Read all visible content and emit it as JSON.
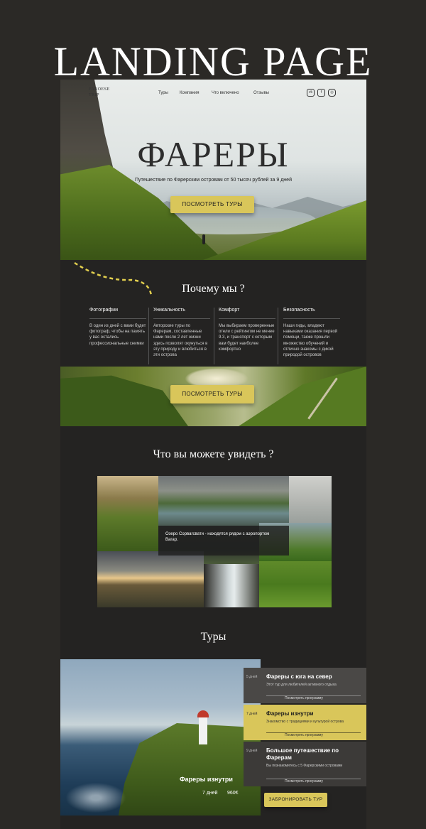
{
  "heading": "LANDING PAGE",
  "nav": {
    "logo": "FAROESE TRIP",
    "links": [
      "Туры",
      "Компания",
      "Что включено",
      "Отзывы"
    ],
    "icons": [
      "vk-icon",
      "facebook-icon",
      "instagram-icon"
    ],
    "icon_glyphs": [
      "vk",
      "f",
      "◎"
    ]
  },
  "hero": {
    "title": "ФАРЕРЫ",
    "subtitle": "Путешествие по Фарерским островам от 50 тысяч рублей за 9 дней",
    "button": "ПОСМОТРЕТЬ ТУРЫ"
  },
  "why": {
    "title": "Почему мы ?",
    "features": [
      {
        "title": "Фотографии",
        "text": "В один из дней с вами будет фотограф, чтобы на память у вас остались профессиональные снимки"
      },
      {
        "title": "Уникальность",
        "text": "Авторские туры по Фарерам, составленные нами после 2 лет жизни здесь позволят окунуться в эту природу и влюбиться в эти острова"
      },
      {
        "title": "Комфорт",
        "text": "Мы выбираем проверенные отели с рейтингом не менее 9.3, и транспорт с которым вам будет наиболее комфортно"
      },
      {
        "title": "Безопасность",
        "text": "Наши гиды, владеют навыками оказания первой помощи, также прошли множество обучений и отлично знакомы с дикой природой островов"
      }
    ],
    "button": "ПОСМОТРЕТЬ ТУРЫ"
  },
  "see": {
    "title": "Что вы можете увидеть ?",
    "caption": "Озеро Сорвагсвати - находятся рядом с аэропортом Вагар."
  },
  "tours": {
    "title": "Туры",
    "photo_name": "Фареры изнутри",
    "photo_days": "7 дней",
    "photo_price": "960€",
    "cards": [
      {
        "days": "5 дней",
        "name": "Фареры с юга на север",
        "desc": "Этот тур для любителей активного отдыха",
        "link": "Посмотреть программу"
      },
      {
        "days": "7 дней",
        "name": "Фареры изнутри",
        "desc": "Знакомство с традициями и культурой острова",
        "link": "Посмотреть программу"
      },
      {
        "days": "9 дней",
        "name": "Большое путешествие по Фарерам",
        "desc": "Вы познакомитесь с 5 Фарерскими островами",
        "link": "Посмотреть программу"
      }
    ],
    "book_button": "ЗАБРОНИРОВАТЬ ТУР"
  },
  "colors": {
    "accent": "#d9c65a",
    "background": "#2b2926",
    "section": "#242322",
    "dashed": "#e2cf4e"
  }
}
